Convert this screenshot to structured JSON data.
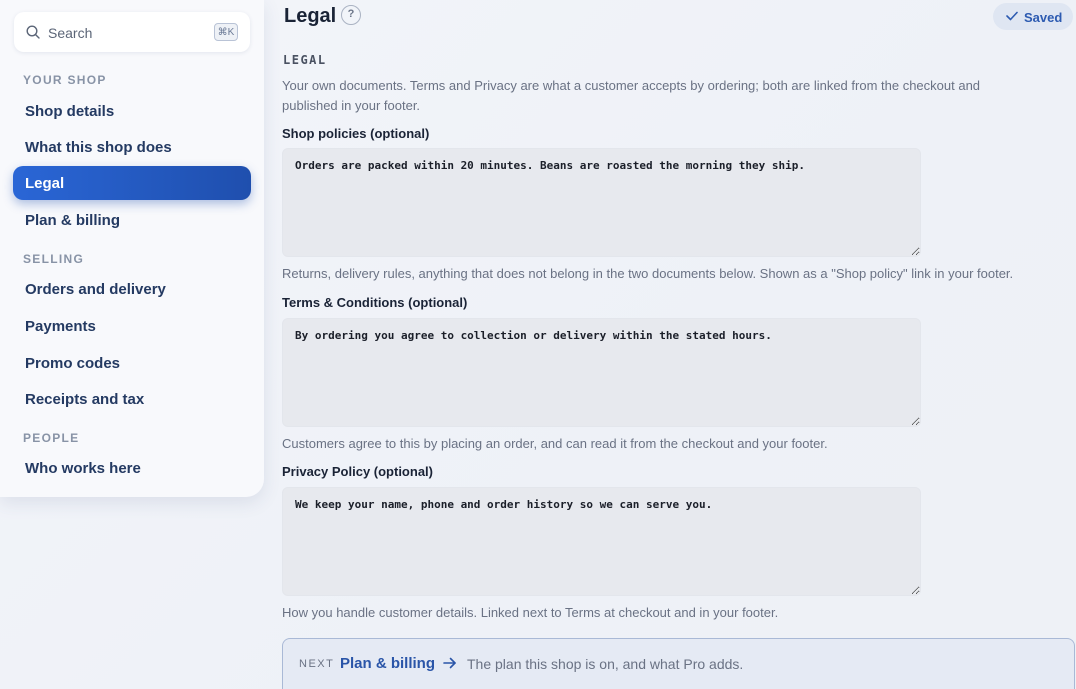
{
  "sidebar": {
    "search": {
      "placeholder": "Search",
      "shortcut": "⌘K"
    },
    "sections": [
      {
        "title": "YOUR SHOP",
        "items": [
          "Shop details",
          "What this shop does",
          "Legal",
          "Plan & billing"
        ]
      },
      {
        "title": "SELLING",
        "items": [
          "Orders and delivery",
          "Payments",
          "Promo codes",
          "Receipts and tax"
        ]
      },
      {
        "title": "PEOPLE",
        "items": [
          "Who works here"
        ]
      }
    ],
    "active_item": "Legal"
  },
  "header": {
    "title": "Legal",
    "help_glyph": "?",
    "saved_label": "Saved"
  },
  "main": {
    "section_heading": "LEGAL",
    "description": "Your own documents. Terms and Privacy are what a customer accepts by ordering; both are linked from the checkout and published in your footer.",
    "fields": [
      {
        "label": "Shop policies (optional)",
        "value": "Orders are packed within 20 minutes. Beans are roasted the morning they ship.",
        "help": "Returns, delivery rules, anything that does not belong in the two documents below. Shown as a \"Shop policy\" link in your footer."
      },
      {
        "label": "Terms & Conditions (optional)",
        "value": "By ordering you agree to collection or delivery within the stated hours.",
        "help": "Customers agree to this by placing an order, and can read it from the checkout and your footer."
      },
      {
        "label": "Privacy Policy (optional)",
        "value": "We keep your name, phone and order history so we can serve you.",
        "help": "How you handle customer details. Linked next to Terms at checkout and in your footer."
      }
    ],
    "next": {
      "label": "NEXT",
      "title": "Plan & billing",
      "description": "The plan this shop is on, and what Pro adds."
    }
  },
  "colors": {
    "accent": "#2a66d6",
    "nav_text": "#243a62",
    "saved_text": "#2d5bb1"
  }
}
